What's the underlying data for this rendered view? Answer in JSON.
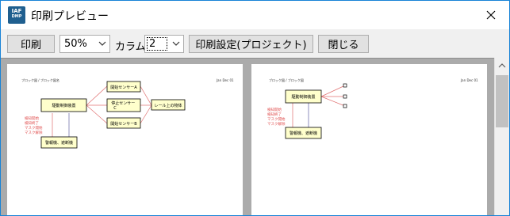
{
  "window": {
    "title": "印刷プレビュー",
    "app_icon_text": "IAF",
    "app_icon_sub": "DMP"
  },
  "toolbar": {
    "print_label": "印刷",
    "zoom_value": "50%",
    "column_label": "カラム",
    "column_value": "2",
    "print_settings_label": "印刷設定(プロジェクト)",
    "close_label": "閉じる"
  },
  "preview": {
    "page1": {
      "header_left": "ブロック図 / ブロック図名",
      "header_right": "Jan Dec 01",
      "nodes": {
        "center": "駆動制御装置",
        "sensor_a": "開始センサーA",
        "stop_sensor": "停止センサー\nC",
        "sensor_b": "開始センサーB",
        "rail": "レール上の物体",
        "alarm": "警報機、遮断機"
      },
      "signals": [
        "検知開始",
        "検知終了",
        "マスク開始",
        "マスク解除"
      ]
    },
    "page2": {
      "header_left": "ブロック図 / ブロック図",
      "header_right": "Jan Dec 01",
      "nodes": {
        "center": "駆動制御装置",
        "alarm": "警報機、遮断機"
      },
      "signals": [
        "検知開始",
        "検知終了",
        "マスク開始",
        "マスク解除"
      ]
    }
  },
  "colors": {
    "accent": "#1883d7",
    "node_fill": "#ffffcc",
    "signal_text": "#e05050",
    "preview_bg": "#ababab"
  },
  "icons": [
    "close-icon",
    "chevron-down-icon",
    "scroll-up-icon"
  ]
}
